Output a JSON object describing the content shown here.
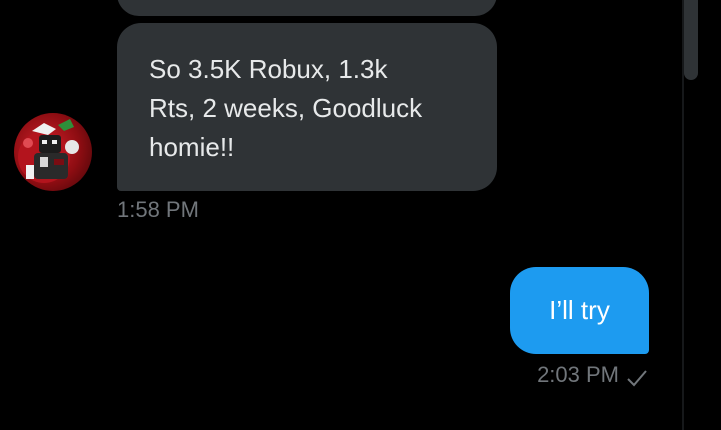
{
  "conversation": {
    "incoming_message": {
      "text": "So 3.5K Robux, 1.3k\nRts, 2 weeks, Goodluck\nhomie!!",
      "time": "1:58 PM"
    },
    "outgoing_message": {
      "text": "I’ll try",
      "time": "2:03 PM",
      "status_icon": "check-icon"
    }
  },
  "colors": {
    "background": "#000000",
    "incoming_bubble": "#2f3336",
    "outgoing_bubble": "#1d9bf0",
    "timestamp": "#71767b"
  }
}
